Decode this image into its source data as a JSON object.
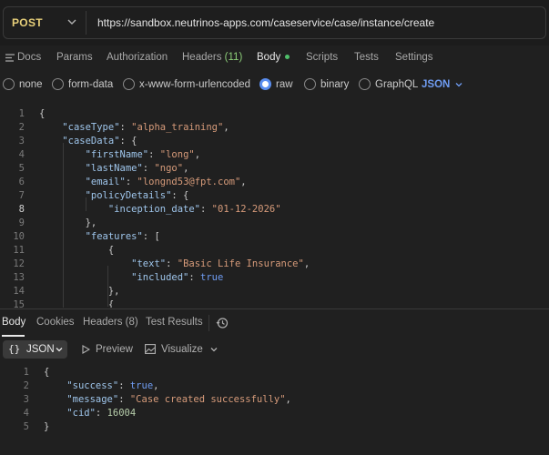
{
  "request": {
    "method": "POST",
    "url": "https://sandbox.neutrinos-apps.com/caseservice/case/instance/create"
  },
  "request_tabs": {
    "docs": "Docs",
    "params": "Params",
    "authorization": "Authorization",
    "headers": "Headers",
    "headers_count": "(11)",
    "body": "Body",
    "scripts": "Scripts",
    "tests": "Tests",
    "settings": "Settings"
  },
  "body_types": {
    "none": "none",
    "form_data": "form-data",
    "urlencoded": "x-www-form-urlencoded",
    "raw": "raw",
    "binary": "binary",
    "graphql": "GraphQL",
    "format": "JSON",
    "selected": "raw"
  },
  "request_body_lines": [
    {
      "n": "1",
      "text": "{"
    },
    {
      "n": "2",
      "text": "    \"caseType\": \"alpha_training\","
    },
    {
      "n": "3",
      "text": "    \"caseData\": {"
    },
    {
      "n": "4",
      "text": "        \"firstName\": \"long\","
    },
    {
      "n": "5",
      "text": "        \"lastName\": \"ngo\","
    },
    {
      "n": "6",
      "text": "        \"email\": \"longnd53@fpt.com\","
    },
    {
      "n": "7",
      "text": "        \"policyDetails\": {"
    },
    {
      "n": "8",
      "text": "            \"inception_date\": \"01-12-2026\""
    },
    {
      "n": "9",
      "text": "        },"
    },
    {
      "n": "10",
      "text": "        \"features\": ["
    },
    {
      "n": "11",
      "text": "            {"
    },
    {
      "n": "12",
      "text": "                \"text\": \"Basic Life Insurance\","
    },
    {
      "n": "13",
      "text": "                \"included\": true"
    },
    {
      "n": "14",
      "text": "            },"
    },
    {
      "n": "15",
      "text": "            {"
    }
  ],
  "response_tabs": {
    "body": "Body",
    "cookies": "Cookies",
    "headers": "Headers",
    "headers_count": "(8)",
    "test_results": "Test Results"
  },
  "response_toolbar": {
    "format": "JSON",
    "preview": "Preview",
    "visualize": "Visualize"
  },
  "response_body_lines": [
    {
      "n": "1",
      "text": "{"
    },
    {
      "n": "2",
      "text": "    \"success\": true,"
    },
    {
      "n": "3",
      "text": "    \"message\": \"Case created successfully\","
    },
    {
      "n": "4",
      "text": "    \"cid\": 16004"
    },
    {
      "n": "5",
      "text": "}"
    }
  ],
  "colors": {
    "method": "#e8d07a",
    "key": "#9fc6ec",
    "string": "#d79b7a",
    "boolean": "#6f9cf2",
    "number": "#b7ceab",
    "accent": "#5a8ef0",
    "active_dot": "#4fbf6a"
  },
  "icons": [
    "chevron-down-icon",
    "docs-icon",
    "history-icon",
    "braces-icon",
    "play-icon",
    "visualize-icon"
  ]
}
